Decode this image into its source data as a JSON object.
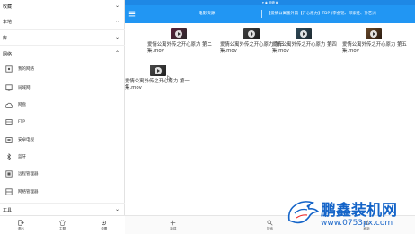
{
  "sidebar": {
    "sections": [
      {
        "label": "收藏",
        "chevron": "⌄"
      },
      {
        "label": "本地",
        "chevron": "⌄"
      },
      {
        "label": "库",
        "chevron": "⌄"
      },
      {
        "label": "网络",
        "chevron": "⌃"
      }
    ],
    "network_items": [
      {
        "label": "我的网络",
        "icon": "network-icon"
      },
      {
        "label": "局域网",
        "icon": "lan-icon"
      },
      {
        "label": "网盘",
        "icon": "cloud-icon"
      },
      {
        "label": "FTP",
        "icon": "ftp-icon"
      },
      {
        "label": "安卓电视",
        "icon": "tv-icon"
      },
      {
        "label": "蓝牙",
        "icon": "bluetooth-icon"
      },
      {
        "label": "远程管理器",
        "icon": "remote-icon"
      },
      {
        "label": "网络管理器",
        "icon": "network-manager-icon"
      }
    ],
    "tools_section": {
      "label": "工具",
      "chevron": "⌄"
    },
    "bottom": [
      {
        "label": "退出",
        "icon": "exit-icon"
      },
      {
        "label": "主题",
        "icon": "theme-icon"
      },
      {
        "label": "设置",
        "icon": "settings-icon"
      }
    ]
  },
  "status_strip": {
    "text": "▾ ◉ 网盘 ▮"
  },
  "topbar": {
    "title": "电影资源",
    "path": "【爱情公寓番外篇【开心原力】TDP (李金铭、邓家佳、孙艺洲"
  },
  "files": [
    {
      "name": "爱情公寓外传之开心原力 第二集.mov"
    },
    {
      "name": "爱情公寓外传之开心原力 第三集.mov"
    },
    {
      "name": "爱情公寓外传之开心原力 第四集.mov"
    },
    {
      "name": "爱情公寓外传之开心原力 第五集.mov"
    },
    {
      "name": "爱情公寓外传之开心原力 第一集.mov"
    }
  ],
  "bottom_actions": [
    {
      "label": "新建",
      "icon": "plus-icon"
    },
    {
      "label": "搜索",
      "icon": "search-icon"
    },
    {
      "label": "刷新",
      "icon": "refresh-icon"
    }
  ],
  "watermark": {
    "text": "鹏鑫装机网",
    "url": "www.0753px.com"
  }
}
